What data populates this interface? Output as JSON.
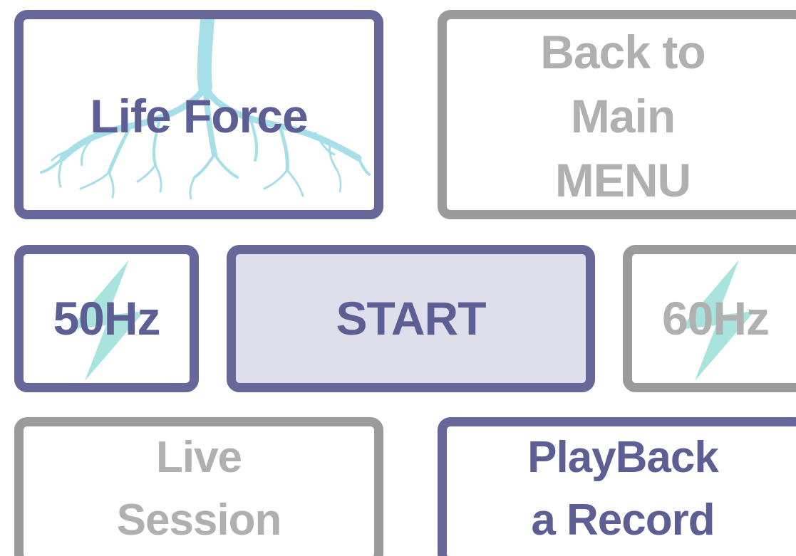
{
  "tiles": {
    "life_force": {
      "label": "Life Force",
      "icon": "roots-icon",
      "state": "selected"
    },
    "back_main": {
      "line1": "Back to",
      "line2": "Main",
      "line3": "MENU",
      "state": "disabled"
    },
    "hz50": {
      "label": "50Hz",
      "icon": "lightning-bolt-icon",
      "state": "selected"
    },
    "start": {
      "label": "START",
      "state": "active"
    },
    "hz60": {
      "label": "60Hz",
      "icon": "lightning-bolt-icon",
      "state": "disabled"
    },
    "live_session": {
      "line1": "Live",
      "line2": "Session",
      "state": "disabled"
    },
    "playback": {
      "line1": "PlayBack",
      "line2": "a Record",
      "state": "active"
    }
  },
  "colors": {
    "accent": "#676899",
    "accent_text": "#5d5e93",
    "inactive_border": "#9b9b9b",
    "inactive_text": "#b0b0b0",
    "start_fill": "#dfdfeb",
    "art": "#a6dfe7",
    "bolt": "#a8e3dd"
  }
}
